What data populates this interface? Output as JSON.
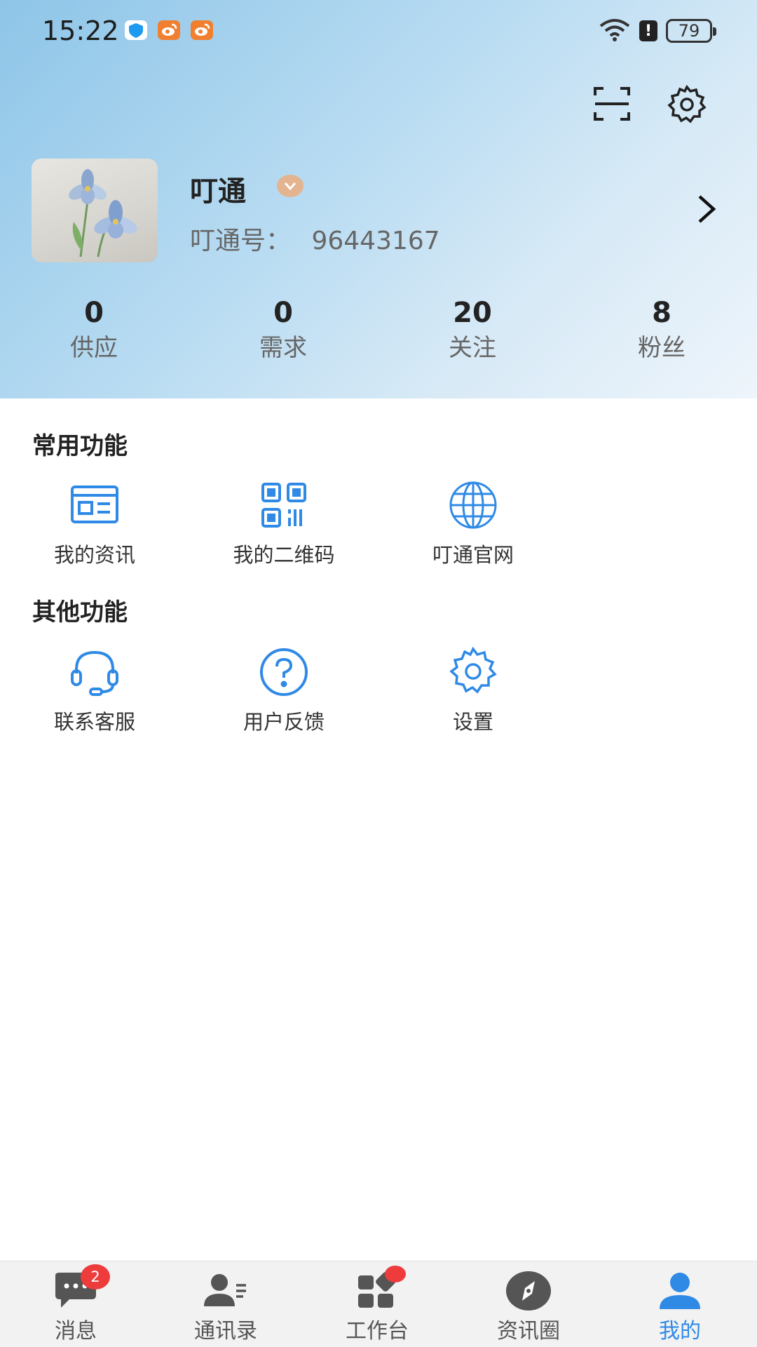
{
  "status_bar": {
    "time": "15:22",
    "battery": "79",
    "icons": [
      "shield-app-icon",
      "weibo-icon",
      "weibo-icon",
      "wifi-icon",
      "alert-icon",
      "battery-icon"
    ]
  },
  "top_actions": {
    "scan_icon": "scan-icon",
    "settings_icon": "gear-icon"
  },
  "profile": {
    "name": "叮通",
    "id_label": "叮通号：",
    "id_value": "96443167"
  },
  "stats": [
    {
      "value": "0",
      "label": "供应"
    },
    {
      "value": "0",
      "label": "需求"
    },
    {
      "value": "20",
      "label": "关注"
    },
    {
      "value": "8",
      "label": "粉丝"
    }
  ],
  "common_section": {
    "title": "常用功能",
    "items": [
      {
        "label": "我的资讯",
        "icon": "news-icon"
      },
      {
        "label": "我的二维码",
        "icon": "qr-code-icon"
      },
      {
        "label": "叮通官网",
        "icon": "globe-icon"
      }
    ]
  },
  "other_section": {
    "title": "其他功能",
    "items": [
      {
        "label": "联系客服",
        "icon": "headset-icon"
      },
      {
        "label": "用户反馈",
        "icon": "question-icon"
      },
      {
        "label": "设置",
        "icon": "gear-icon"
      }
    ]
  },
  "bottom_nav": {
    "items": [
      {
        "label": "消息",
        "icon": "chat-icon",
        "badge": "2"
      },
      {
        "label": "通讯录",
        "icon": "contacts-icon"
      },
      {
        "label": "工作台",
        "icon": "workbench-icon"
      },
      {
        "label": "资讯圈",
        "icon": "compass-icon"
      },
      {
        "label": "我的",
        "icon": "user-icon",
        "active": true
      }
    ]
  },
  "colors": {
    "accent": "#2f8ae6",
    "badge": "#ee3b3b",
    "vip": "#e3b48f"
  }
}
